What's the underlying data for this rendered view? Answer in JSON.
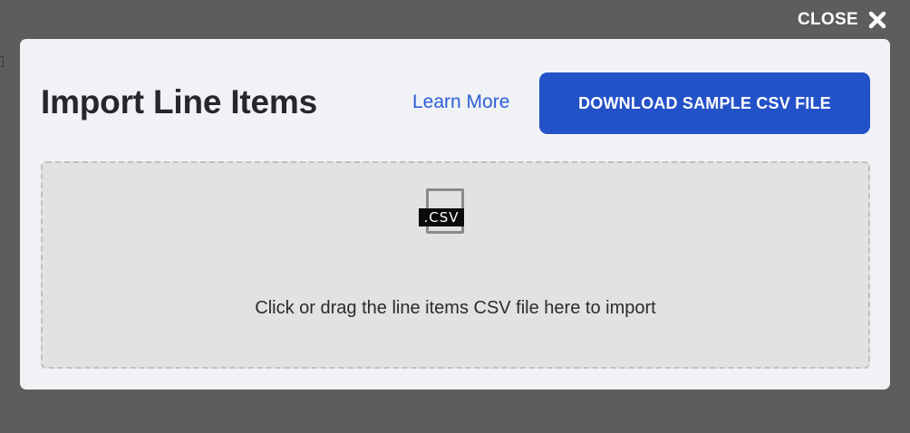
{
  "close": {
    "label": "CLOSE",
    "icon": "close-icon"
  },
  "modal": {
    "title": "Import Line Items",
    "learn_more": "Learn More",
    "download_button": "DOWNLOAD SAMPLE CSV FILE"
  },
  "dropzone": {
    "icon": "csv-file-icon",
    "icon_tag": ".CSV",
    "instruction": "Click or drag the line items CSV file here to import"
  },
  "colors": {
    "backdrop": "#5d5d5c",
    "modal_bg": "#f0f2f6",
    "accent": "#2351c8",
    "link": "#2d5fd6",
    "dropzone_bg": "#e2e2e2"
  }
}
